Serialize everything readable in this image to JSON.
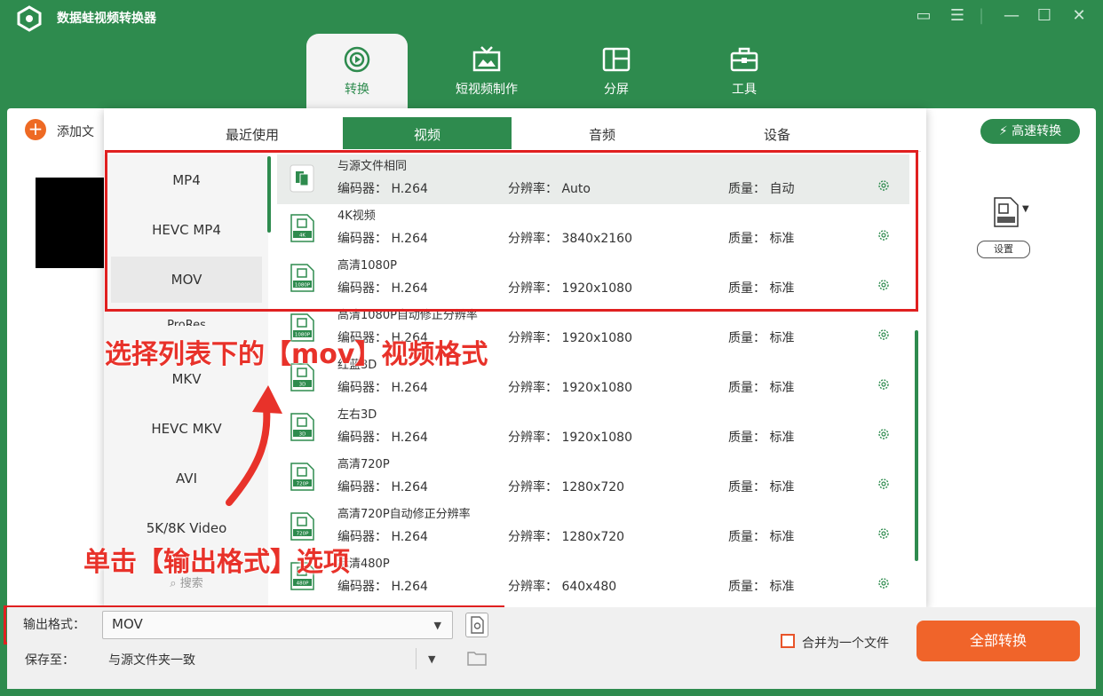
{
  "app": {
    "title": "数据蛙视频转换器"
  },
  "nav_tabs": [
    {
      "label": "转换",
      "icon": "convert-icon",
      "active": true
    },
    {
      "label": "短视频制作",
      "icon": "tv-icon"
    },
    {
      "label": "分屏",
      "icon": "split-screen-icon"
    },
    {
      "label": "工具",
      "icon": "toolbox-icon"
    }
  ],
  "toolbar": {
    "add_file_label": "添加文",
    "fast_convert_label": "高速转换",
    "settings_label": "设置"
  },
  "format_popup": {
    "tabs": [
      "最近使用",
      "视频",
      "音频",
      "设备"
    ],
    "active_tab": "视频",
    "categories": [
      "MP4",
      "HEVC MP4",
      "MOV",
      "ProRes",
      "MKV",
      "HEVC MKV",
      "AVI",
      "5K/8K Video",
      "搜索"
    ],
    "selected_category": "MOV",
    "field_labels": {
      "codec": "编码器：",
      "resolution": "分辨率：",
      "quality": "质量："
    },
    "presets": [
      {
        "name": "与源文件相同",
        "badge": "",
        "codec": "H.264",
        "resolution": "Auto",
        "quality": "自动"
      },
      {
        "name": "4K视频",
        "badge": "4K",
        "codec": "H.264",
        "resolution": "3840x2160",
        "quality": "标准"
      },
      {
        "name": "高清1080P",
        "badge": "1080P",
        "codec": "H.264",
        "resolution": "1920x1080",
        "quality": "标准"
      },
      {
        "name": "高清1080P自动修正分辨率",
        "badge": "1080P",
        "codec": "H.264",
        "resolution": "1920x1080",
        "quality": "标准"
      },
      {
        "name": "红蓝3D",
        "badge": "3D",
        "codec": "H.264",
        "resolution": "1920x1080",
        "quality": "标准"
      },
      {
        "name": "左右3D",
        "badge": "3D",
        "codec": "H.264",
        "resolution": "1920x1080",
        "quality": "标准"
      },
      {
        "name": "高清720P",
        "badge": "720P",
        "codec": "H.264",
        "resolution": "1280x720",
        "quality": "标准"
      },
      {
        "name": "高清720P自动修正分辨率",
        "badge": "720P",
        "codec": "H.264",
        "resolution": "1280x720",
        "quality": "标准"
      },
      {
        "name": "标清480P",
        "badge": "480P",
        "codec": "H.264",
        "resolution": "640x480",
        "quality": "标准"
      }
    ]
  },
  "annotations": {
    "select_mov": "选择列表下的【mov】视频格式",
    "click_output": "单击【输出格式】选项"
  },
  "bottom": {
    "output_format_label": "输出格式：",
    "output_format_value": "MOV",
    "save_to_label": "保存至：",
    "save_to_value": "与源文件夹一致",
    "merge_label": "合并为一个文件",
    "convert_all_label": "全部转换"
  },
  "colors": {
    "brand_green": "#2e8b4e",
    "accent_orange": "#f0642a",
    "annotation_red": "#e8322a"
  }
}
